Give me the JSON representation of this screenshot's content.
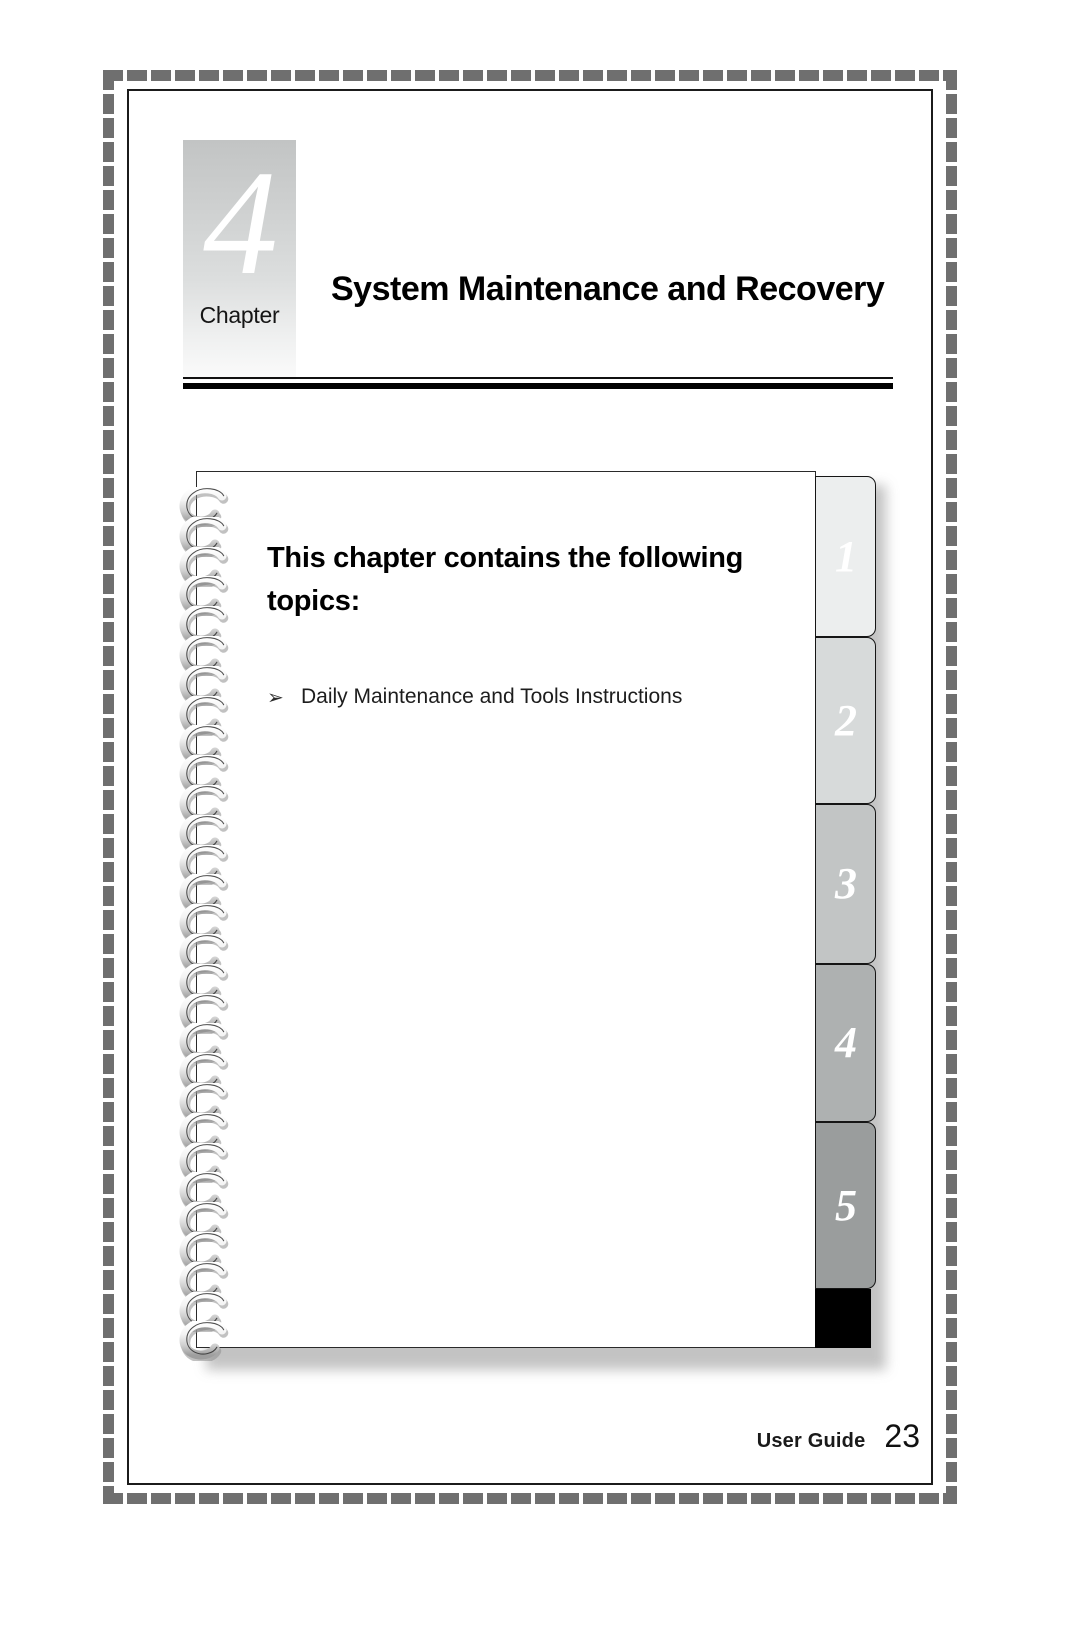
{
  "document": {
    "type": "user-guide-chapter-opener",
    "chapter": {
      "number": "4",
      "word_label": "Chapter",
      "title": "System Maintenance and Recovery"
    },
    "notebook": {
      "heading": "This chapter contains the following topics:",
      "bullet_marker": "➢",
      "topics": [
        "Daily Maintenance and Tools Instructions"
      ],
      "side_tabs": [
        {
          "label": "1",
          "color": "#eceeee"
        },
        {
          "label": "2",
          "color": "#d7dada"
        },
        {
          "label": "3",
          "color": "#c2c5c5"
        },
        {
          "label": "4",
          "color": "#aeb1b1"
        },
        {
          "label": "5",
          "color": "#9a9d9d"
        }
      ],
      "tab_footer_color": "#000000"
    },
    "footer": {
      "label": "User Guide",
      "page_number": "23"
    },
    "colors": {
      "border_dash": "#6f6f6f",
      "inner_frame": "#1b1b1b",
      "rule": "#000000",
      "badge_gradient_top": "#c2c4c4",
      "badge_gradient_bottom": "#fbfbfb",
      "text": "#000000",
      "page_background": "#ffffff"
    }
  }
}
